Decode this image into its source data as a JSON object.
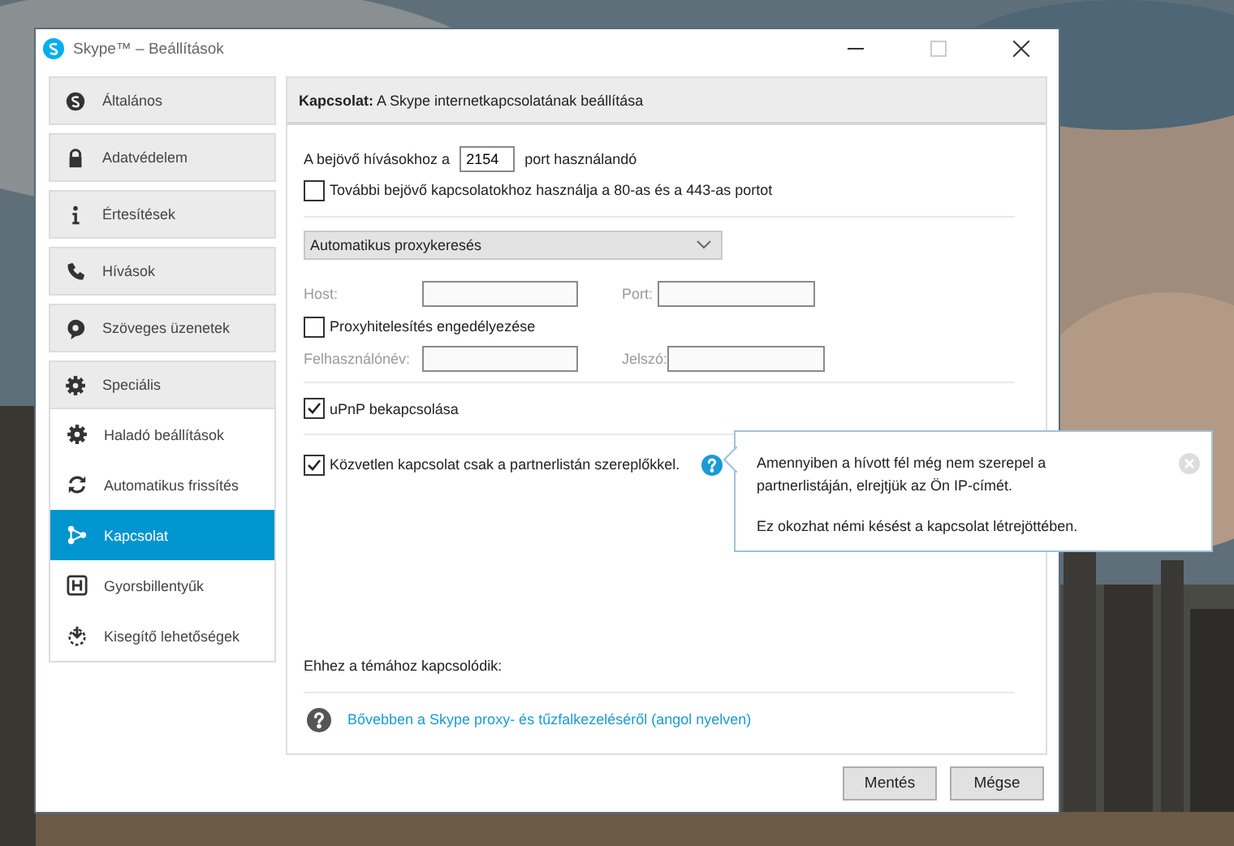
{
  "window": {
    "title": "Skype™ – Beállítások"
  },
  "sidebar": {
    "items": [
      {
        "label": "Általános",
        "selected": false
      },
      {
        "label": "Adatvédelem",
        "selected": false
      },
      {
        "label": "Értesítések",
        "selected": false
      },
      {
        "label": "Hívások",
        "selected": false
      },
      {
        "label": "Szöveges üzenetek",
        "selected": false
      },
      {
        "label": "Speciális",
        "selected": false,
        "children": [
          {
            "label": "Haladó beállítások",
            "selected": false
          },
          {
            "label": "Automatikus frissítés",
            "selected": false
          },
          {
            "label": "Kapcsolat",
            "selected": true
          },
          {
            "label": "Gyorsbillentyűk",
            "selected": false
          },
          {
            "label": "Kisegítő lehetőségek",
            "selected": false
          }
        ]
      }
    ]
  },
  "panel": {
    "header": "**Kapcsolat:** A Skype internetkapcsolatának beállítása",
    "port": {
      "prefix": "A bejövő hívásokhoz a",
      "value": "2154",
      "suffix": "port használandó"
    },
    "alt_ports": {
      "label": "További bejövő kapcsolatokhoz használja a 80-as és a 443-as portot",
      "checked": false
    },
    "proxy_select": {
      "value": "Automatikus proxykeresés"
    },
    "host_fields": [
      {
        "label": "Host:",
        "disabled": true
      },
      {
        "label": "Port:",
        "disabled": true
      }
    ],
    "proxy_auth": {
      "label": "Proxyhitelesítés engedélyezése",
      "checked": false
    },
    "credential_fields": [
      {
        "label": "Felhasználónév:",
        "disabled": true
      },
      {
        "label": "Jelszó:",
        "disabled": true
      }
    ],
    "upnp": {
      "label": "uPnP bekapcsolása",
      "checked": true
    },
    "direct": {
      "label": "Közvetlen kapcsolat csak a partnerlistán szereplőkkel.",
      "checked": true
    },
    "tooltip": {
      "paragraphs": [
        "Amennyiben a hívott fél még nem szerepel a partnerlistáján, elrejtjük az Ön IP-címét.",
        "Ez okozhat némi késést a kapcsolat létrejöttében."
      ]
    },
    "related": {
      "heading": "Ehhez a témához kapcsolódik:",
      "link": "Bővebben a Skype proxy- és tűzfalkezeléséről (angol nyelven)"
    }
  },
  "buttons": [
    "Mentés",
    "Mégse"
  ]
}
